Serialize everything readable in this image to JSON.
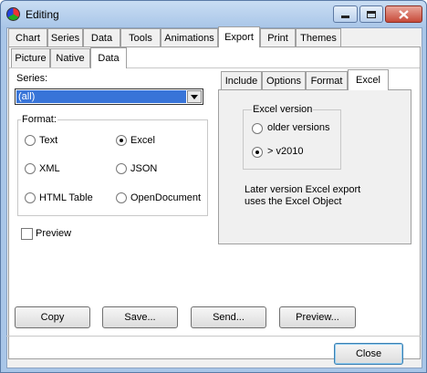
{
  "window": {
    "title": "Editing"
  },
  "main_tabs": [
    "Chart",
    "Series",
    "Data",
    "Tools",
    "Animations",
    "Export",
    "Print",
    "Themes"
  ],
  "sub_tabs": [
    "Picture",
    "Native",
    "Data"
  ],
  "series": {
    "label": "Series:",
    "value": "(all)"
  },
  "format": {
    "label": "Format:",
    "options": [
      "Text",
      "Excel",
      "XML",
      "JSON",
      "HTML Table",
      "OpenDocument"
    ],
    "selected": "Excel"
  },
  "preview_check": {
    "label": "Preview",
    "checked": false
  },
  "right_tabs": [
    "Include",
    "Options",
    "Format",
    "Excel"
  ],
  "excel": {
    "group_label": "Excel version",
    "options": [
      "older versions",
      "> v2010"
    ],
    "selected": "> v2010",
    "note_line1": "Later version Excel export",
    "note_line2": "uses the Excel Object"
  },
  "actions": [
    "Copy",
    "Save...",
    "Send...",
    "Preview..."
  ],
  "close_label": "Close"
}
